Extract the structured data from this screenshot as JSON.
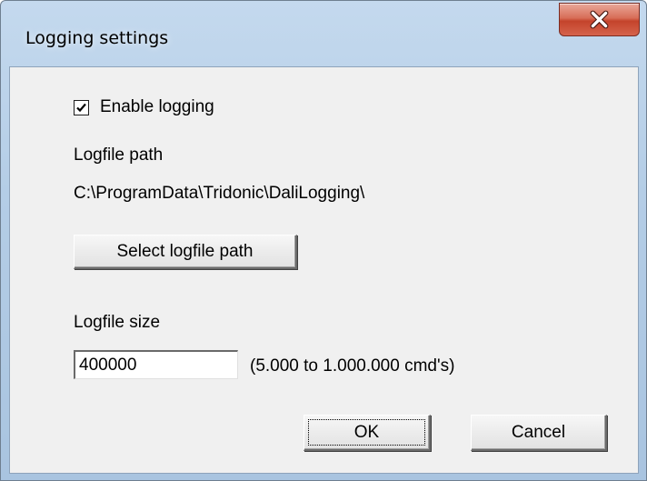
{
  "window": {
    "title": "Logging settings"
  },
  "titlebar": {
    "close_icon": "close-icon"
  },
  "logging": {
    "enable_label": "Enable logging",
    "enabled": true,
    "path_label": "Logfile path",
    "path_value": "C:\\ProgramData\\Tridonic\\DaliLogging\\",
    "select_path_button": "Select logfile path",
    "size_label": "Logfile size",
    "size_value": "400000",
    "size_range_hint": "(5.000 to 1.000.000 cmd's)"
  },
  "buttons": {
    "ok": "OK",
    "cancel": "Cancel"
  },
  "colors": {
    "close_button": "#c4432b",
    "dialog_background": "#f0f0f0",
    "frame": "#b4cde6"
  }
}
